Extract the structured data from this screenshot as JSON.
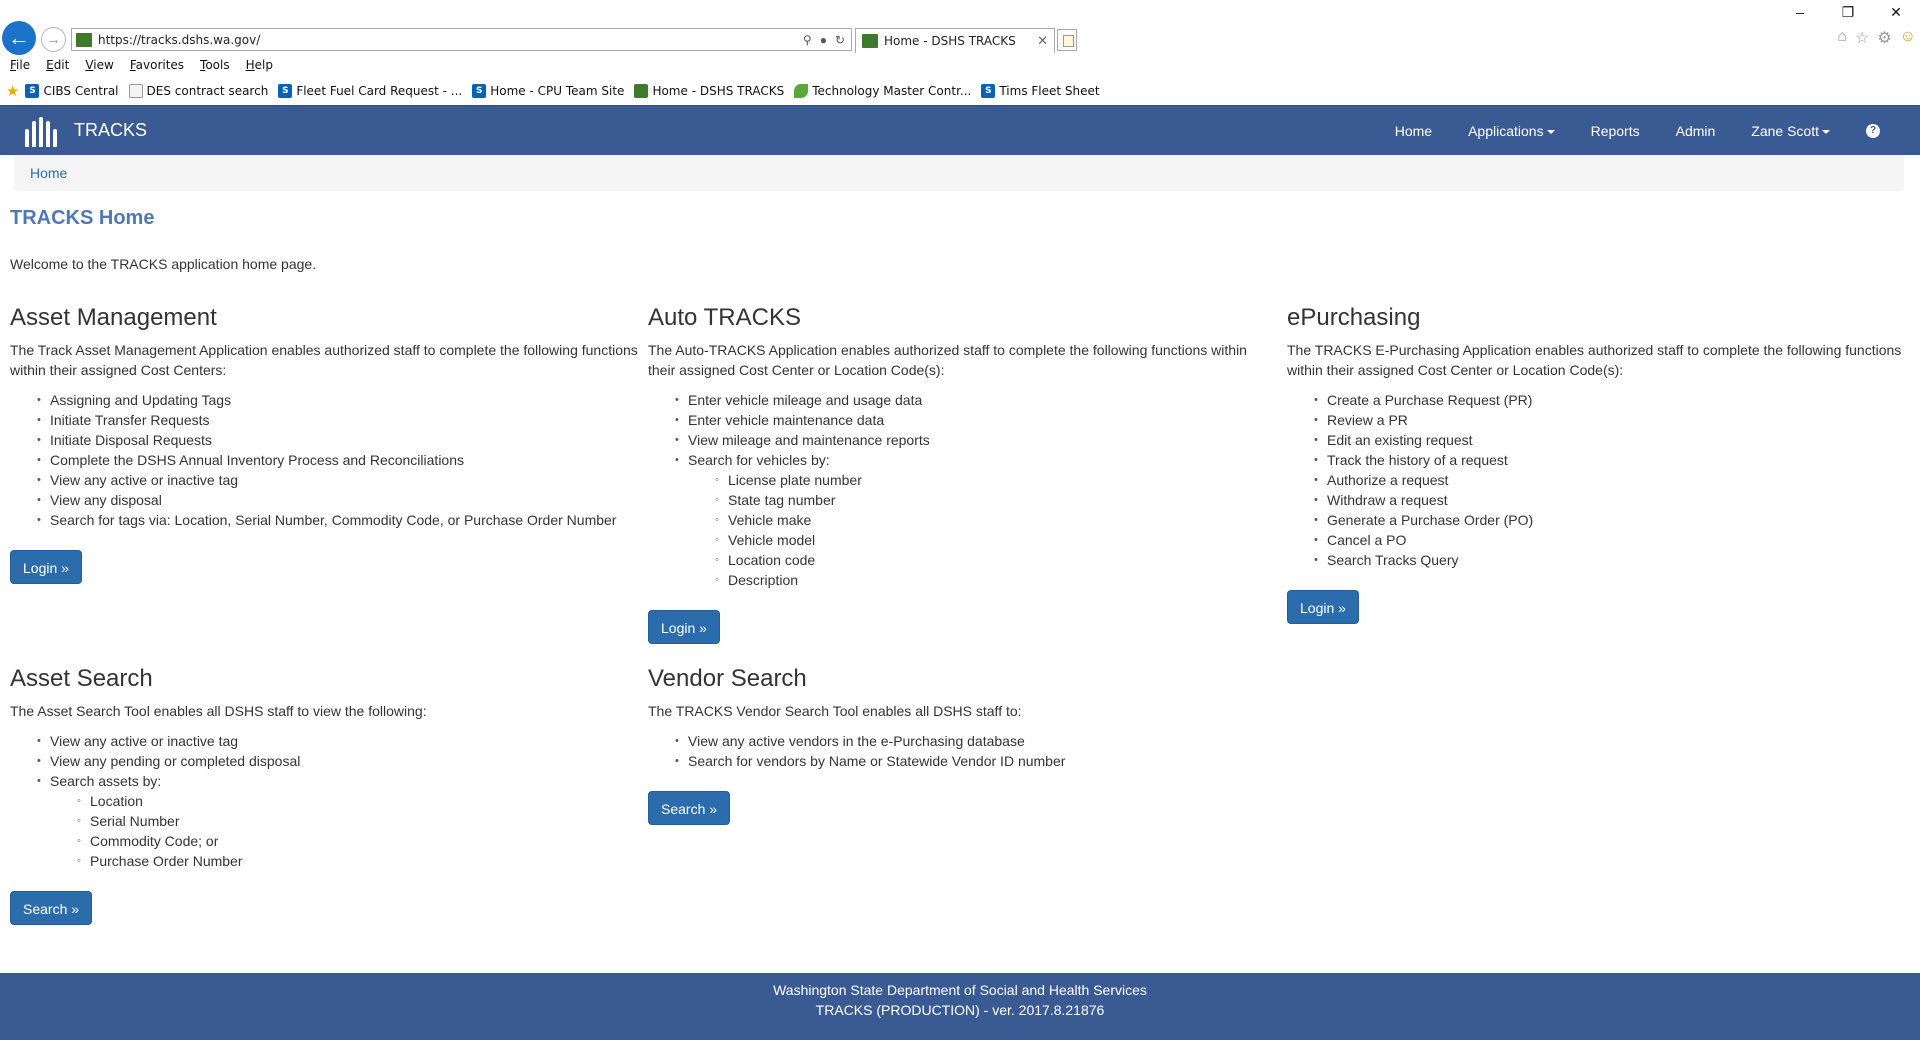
{
  "browser": {
    "url": "https://tracks.dshs.wa.gov/",
    "tab_title": "Home - DSHS TRACKS",
    "menu": [
      "File",
      "Edit",
      "View",
      "Favorites",
      "Tools",
      "Help"
    ],
    "favorites": [
      {
        "label": "CIBS Central",
        "icon": "sharepoint-icon"
      },
      {
        "label": "DES contract search",
        "icon": "doc-icon"
      },
      {
        "label": "Fleet Fuel Card Request - ...",
        "icon": "sharepoint-icon"
      },
      {
        "label": "Home - CPU Team Site",
        "icon": "sharepoint-icon"
      },
      {
        "label": "Home - DSHS TRACKS",
        "icon": "site-icon"
      },
      {
        "label": "Technology Master Contr...",
        "icon": "leaf-icon"
      },
      {
        "label": "Tims Fleet Sheet",
        "icon": "sharepoint-icon"
      }
    ]
  },
  "navbar": {
    "brand": "TRACKS",
    "links": {
      "home": "Home",
      "applications": "Applications",
      "reports": "Reports",
      "admin": "Admin",
      "user": "Zane Scott"
    },
    "help_glyph": "?"
  },
  "breadcrumb": {
    "home": "Home"
  },
  "page": {
    "title": "TRACKS Home",
    "welcome": "Welcome to the TRACKS application home page."
  },
  "sections": {
    "asset_management": {
      "title": "Asset Management",
      "description": "The Track Asset Management Application enables authorized staff to complete the following functions within their assigned Cost Centers:",
      "items": [
        "Assigning and Updating Tags",
        "Initiate Transfer Requests",
        "Initiate Disposal Requests",
        "Complete the DSHS Annual Inventory Process and Reconciliations",
        "View any active or inactive tag",
        "View any disposal",
        "Search for tags via: Location, Serial Number, Commodity Code, or Purchase Order Number"
      ],
      "button": "Login »"
    },
    "auto_tracks": {
      "title": "Auto TRACKS",
      "description": "The Auto-TRACKS Application enables authorized staff to complete the following functions within their assigned Cost Center or Location Code(s):",
      "items": [
        "Enter vehicle mileage and usage data",
        "Enter vehicle maintenance data",
        "View mileage and maintenance reports",
        "Search for vehicles by:"
      ],
      "sub_items": [
        "License plate number",
        "State tag number",
        "Vehicle make",
        "Vehicle model",
        "Location code",
        "Description"
      ],
      "button": "Login »"
    },
    "epurchasing": {
      "title": "ePurchasing",
      "description": "The TRACKS E-Purchasing Application enables authorized staff to complete the following functions within their assigned Cost Center or Location Code(s):",
      "items": [
        "Create a Purchase Request (PR)",
        "Review a PR",
        "Edit an existing request",
        "Track the history of a request",
        "Authorize a request",
        "Withdraw a request",
        "Generate a Purchase Order (PO)",
        "Cancel a PO",
        "Search Tracks Query"
      ],
      "button": "Login »"
    },
    "asset_search": {
      "title": "Asset Search",
      "description": "The Asset Search Tool enables all DSHS staff to view the following:",
      "items": [
        "View any active or inactive tag",
        "View any pending or completed disposal",
        "Search assets by:"
      ],
      "sub_items": [
        "Location",
        "Serial Number",
        "Commodity Code; or",
        "Purchase Order Number"
      ],
      "button": "Search »"
    },
    "vendor_search": {
      "title": "Vendor Search",
      "description": "The TRACKS Vendor Search Tool enables all DSHS staff to:",
      "items": [
        "View any active vendors in the e-Purchasing database",
        "Search for vendors by Name or Statewide Vendor ID number"
      ],
      "button": "Search »"
    }
  },
  "footer": {
    "line1": "Washington State Department of Social and Health Services",
    "line2": "TRACKS (PRODUCTION) - ver. 2017.8.21876"
  },
  "colors": {
    "navbar": "#395a93",
    "title": "#4f79b5",
    "button": "#2b6cad",
    "link": "#2a6ebb"
  }
}
